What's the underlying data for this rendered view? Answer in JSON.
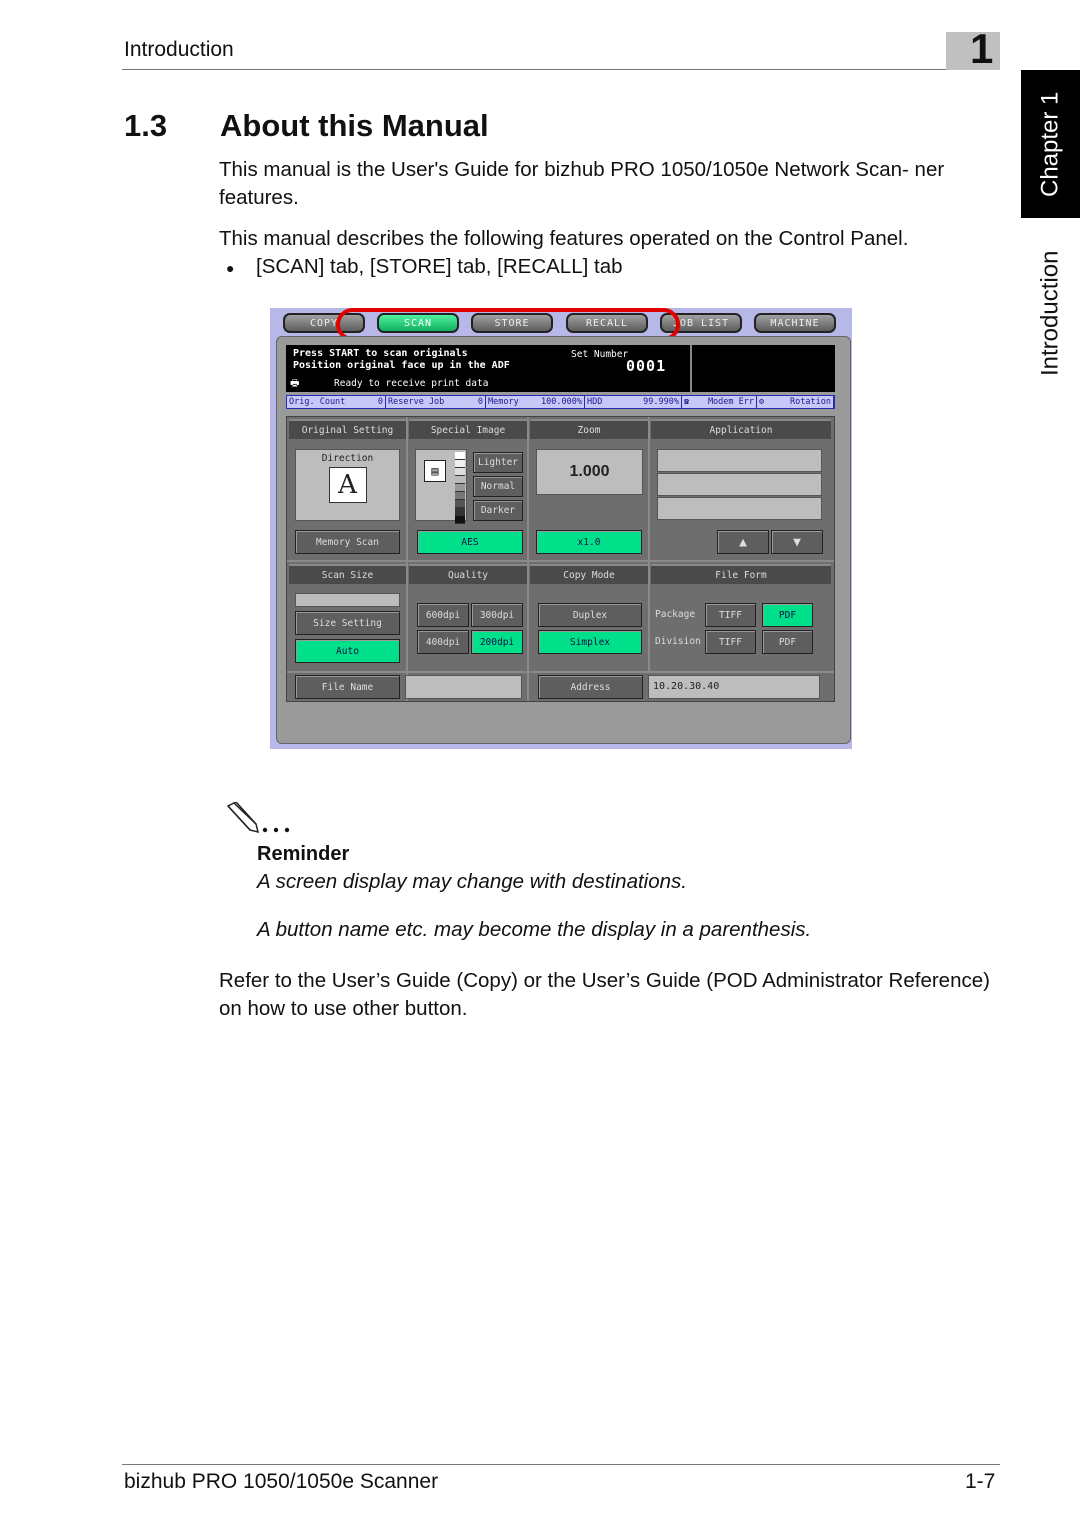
{
  "header": {
    "section": "Introduction",
    "chapter_number": "1"
  },
  "side_tab": {
    "chapter": "Chapter 1",
    "section": "Introduction"
  },
  "title": {
    "number": "1.3",
    "text": "About this Manual"
  },
  "body": {
    "p1": "This manual is the User's Guide for bizhub PRO 1050/1050e Network Scan- ner features.",
    "p2": "This manual describes the following features operated on the Control Panel.",
    "bullet_marker": "●",
    "bullet": "[SCAN] tab, [STORE] tab, [RECALL] tab",
    "p3": "Refer to the User’s Guide (Copy) or the User’s Guide (POD Administrator Reference) on how to use other button."
  },
  "reminder": {
    "icon": "pencil-note-icon",
    "dots": "...",
    "title": "Reminder",
    "lines": [
      "A screen display may change with destinations.",
      "A button name etc. may become the display in a parenthesis."
    ]
  },
  "footer": {
    "product": "bizhub PRO 1050/1050e Scanner",
    "page": "1-7"
  },
  "panel": {
    "tabs": [
      {
        "label": "COPY",
        "active": false
      },
      {
        "label": "SCAN",
        "active": true
      },
      {
        "label": "STORE",
        "active": false
      },
      {
        "label": "RECALL",
        "active": false
      },
      {
        "label": "JOB LIST",
        "active": false
      },
      {
        "label": "MACHINE",
        "active": false
      }
    ],
    "message": {
      "line1": "Press START to scan originals",
      "line2": "Position original face up in the ADF",
      "line3": "Ready to receive print data",
      "set_number_label": "Set Number",
      "set_number": "0001"
    },
    "status": {
      "orig_count_label": "Orig. Count",
      "orig_count": "0",
      "reserve_job_label": "Reserve Job",
      "reserve_job": "0",
      "memory_label": "Memory",
      "memory": "100.000%",
      "hdd_label": "HDD",
      "hdd": "99.990%",
      "modem": "Modem Err",
      "rotation": "Rotation"
    },
    "headers": {
      "original_setting": "Original Setting",
      "special_image": "Special Image",
      "zoom": "Zoom",
      "application": "Application",
      "scan_size": "Scan Size",
      "quality": "Quality",
      "copy_mode": "Copy Mode",
      "file_form": "File Form"
    },
    "direction_label": "Direction",
    "direction_glyph": "A",
    "density": {
      "lighter": "Lighter",
      "normal": "Normal",
      "darker": "Darker"
    },
    "memory_scan": "Memory Scan",
    "aes": "AES",
    "zoom_value": "1.000",
    "zoom_preset": "x1.0",
    "arrow_up": "▲",
    "arrow_down": "▼",
    "size_setting": "Size Setting",
    "auto": "Auto",
    "quality": {
      "q600": "600dpi",
      "q300": "300dpi",
      "q400": "400dpi",
      "q200": "200dpi",
      "selected": "200dpi"
    },
    "copy_mode": {
      "duplex": "Duplex",
      "simplex": "Simplex",
      "selected": "Simplex"
    },
    "file_form": {
      "package": "Package",
      "division": "Division",
      "tiff": "TIFF",
      "pdf": "PDF",
      "package_selected": "PDF"
    },
    "file_name": "File Name",
    "address_label": "Address",
    "address_value": "10.20.30.40",
    "colors": {
      "active_green": "#00e08a",
      "highlight_red": "#e00000"
    }
  }
}
